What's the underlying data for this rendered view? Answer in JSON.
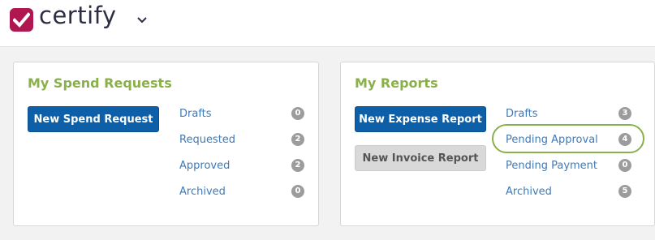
{
  "app": {
    "name": "certify",
    "logo_icon": "checkmark-icon",
    "accent": "#b0164f"
  },
  "spend": {
    "title": "My Spend Requests",
    "new_button": "New Spend Request",
    "items": [
      {
        "label": "Drafts",
        "count": "0"
      },
      {
        "label": "Requested",
        "count": "2"
      },
      {
        "label": "Approved",
        "count": "2"
      },
      {
        "label": "Archived",
        "count": "0"
      }
    ]
  },
  "reports": {
    "title": "My Reports",
    "new_expense_button": "New Expense Report",
    "new_invoice_button": "New Invoice Report",
    "items": [
      {
        "label": "Drafts",
        "count": "3"
      },
      {
        "label": "Pending Approval",
        "count": "4"
      },
      {
        "label": "Pending Payment",
        "count": "0"
      },
      {
        "label": "Archived",
        "count": "5"
      }
    ],
    "highlight_color": "#8ab04a"
  }
}
